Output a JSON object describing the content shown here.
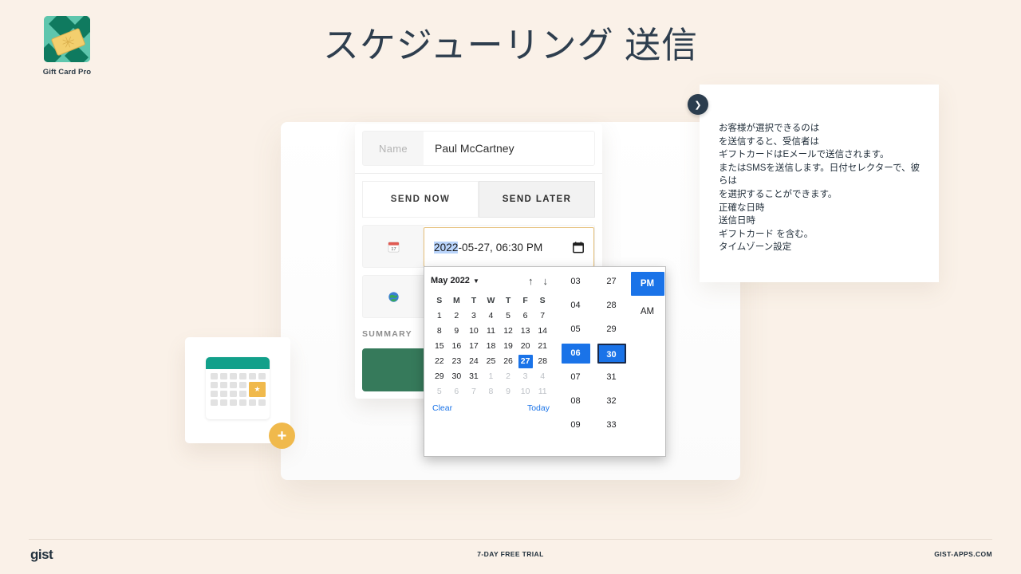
{
  "brand": {
    "label": "Gift Card Pro",
    "logo_icon": "giftcard-logo-icon",
    "colors": {
      "teal_light": "#5ec6ad",
      "teal_dark": "#0f7a5f",
      "card_yellow": "#f3cf6e"
    }
  },
  "header": {
    "title": "スケジューリング 送信"
  },
  "form": {
    "name_label": "Name",
    "name_value": "Paul McCartney",
    "tabs": [
      {
        "label": "SEND NOW",
        "active": false
      },
      {
        "label": "SEND LATER",
        "active": true
      }
    ],
    "date_row_icon": "calendar-emoji-icon",
    "timezone_row_icon": "globe-emoji-icon",
    "summary_label": "SUMMARY",
    "summary_swatch_color": "#367a5b"
  },
  "date_input": {
    "year": "2022",
    "rest": "-05-27, 06:30 PM",
    "full_value": "2022-05-27, 06:30 PM",
    "picker_icon": "calendar-icon",
    "focus_border_color": "#e6c07a",
    "selection_color": "#b9d4fb"
  },
  "picker": {
    "month_label": "May 2022",
    "month_caret_icon": "chevron-down-icon",
    "nav_prev_icon": "arrow-up-icon",
    "nav_next_icon": "arrow-down-icon",
    "nav_prev_glyph": "↑",
    "nav_next_glyph": "↓",
    "weekdays": [
      "S",
      "M",
      "T",
      "W",
      "T",
      "F",
      "S"
    ],
    "weeks": [
      [
        {
          "d": "1"
        },
        {
          "d": "2"
        },
        {
          "d": "3"
        },
        {
          "d": "4"
        },
        {
          "d": "5"
        },
        {
          "d": "6"
        },
        {
          "d": "7"
        }
      ],
      [
        {
          "d": "8"
        },
        {
          "d": "9"
        },
        {
          "d": "10"
        },
        {
          "d": "11"
        },
        {
          "d": "12"
        },
        {
          "d": "13"
        },
        {
          "d": "14"
        }
      ],
      [
        {
          "d": "15"
        },
        {
          "d": "16"
        },
        {
          "d": "17"
        },
        {
          "d": "18"
        },
        {
          "d": "19"
        },
        {
          "d": "20"
        },
        {
          "d": "21"
        }
      ],
      [
        {
          "d": "22"
        },
        {
          "d": "23"
        },
        {
          "d": "24"
        },
        {
          "d": "25"
        },
        {
          "d": "26"
        },
        {
          "d": "27",
          "state": "selected"
        },
        {
          "d": "28"
        }
      ],
      [
        {
          "d": "29"
        },
        {
          "d": "30"
        },
        {
          "d": "31"
        },
        {
          "d": "1",
          "state": "muted"
        },
        {
          "d": "2",
          "state": "muted"
        },
        {
          "d": "3",
          "state": "muted"
        },
        {
          "d": "4",
          "state": "muted"
        }
      ],
      [
        {
          "d": "5",
          "state": "muted"
        },
        {
          "d": "6",
          "state": "muted"
        },
        {
          "d": "7",
          "state": "muted"
        },
        {
          "d": "8",
          "state": "muted"
        },
        {
          "d": "9",
          "state": "muted"
        },
        {
          "d": "10",
          "state": "muted"
        },
        {
          "d": "11",
          "state": "muted"
        }
      ]
    ],
    "clear_label": "Clear",
    "today_label": "Today",
    "hours": [
      {
        "v": "03"
      },
      {
        "v": "04"
      },
      {
        "v": "05"
      },
      {
        "v": "06",
        "state": "selected"
      },
      {
        "v": "07"
      },
      {
        "v": "08"
      },
      {
        "v": "09"
      }
    ],
    "minutes": [
      {
        "v": "27"
      },
      {
        "v": "28"
      },
      {
        "v": "29"
      },
      {
        "v": "30",
        "state": "focused"
      },
      {
        "v": "31"
      },
      {
        "v": "32"
      },
      {
        "v": "33"
      }
    ],
    "meridiem": [
      {
        "v": "PM",
        "state": "selected"
      },
      {
        "v": "AM"
      }
    ],
    "accent_color": "#1a73e8",
    "focus_ring_color": "#18294a"
  },
  "annotation": {
    "chevron_icon": "chevron-right-icon",
    "lines": [
      "お客様が選択できるのは",
      "を送信すると、受信者は",
      "ギフトカードはEメールで送信されます。",
      "またはSMSを送信します。日付セレクターで、彼らは",
      "を選択することができます。",
      "正確な日時",
      "送信日時",
      "ギフトカード を含む。",
      "タイムゾーン設定"
    ]
  },
  "illustration": {
    "name": "calendar-illustration",
    "header_color": "#12a08a",
    "star_glyph": "★",
    "plus_glyph": "+",
    "plus_color": "#f0b94c"
  },
  "footer": {
    "left": "gist",
    "center": "7-DAY FREE TRIAL",
    "right": "GIST-APPS.COM"
  }
}
